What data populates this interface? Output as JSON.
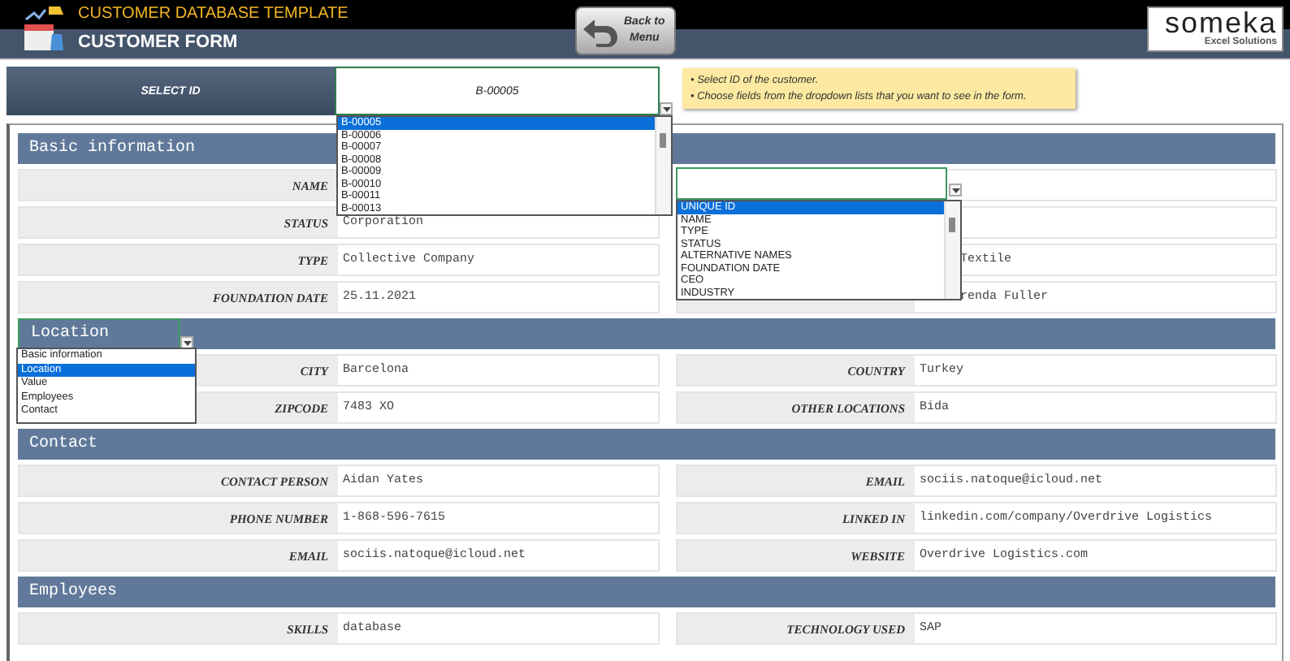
{
  "header": {
    "app_title": "CUSTOMER DATABASE TEMPLATE",
    "form_title": "CUSTOMER FORM",
    "back_button": [
      "Back to",
      "Menu"
    ],
    "logo": {
      "name": "someka",
      "tagline": "Excel Solutions"
    }
  },
  "select_id": {
    "label": "SELECT ID",
    "value": "B-00005",
    "options": [
      {
        "label": "B-00005",
        "selected": true
      },
      {
        "label": "B-00006",
        "selected": false
      },
      {
        "label": "B-00007",
        "selected": false
      },
      {
        "label": "B-00008",
        "selected": false
      },
      {
        "label": "B-00009",
        "selected": false
      },
      {
        "label": "B-00010",
        "selected": false
      },
      {
        "label": "B-00011",
        "selected": false
      },
      {
        "label": "B-00013",
        "selected": false
      }
    ]
  },
  "notes": [
    "• Select ID of the customer.",
    "• Choose fields from the dropdown lists that you want to see in the form."
  ],
  "field_picker": {
    "options": [
      {
        "label": "UNIQUE ID",
        "selected": true
      },
      {
        "label": "NAME",
        "selected": false
      },
      {
        "label": "TYPE",
        "selected": false
      },
      {
        "label": "STATUS",
        "selected": false
      },
      {
        "label": "ALTERNATIVE NAMES",
        "selected": false
      },
      {
        "label": "FOUNDATION DATE",
        "selected": false
      },
      {
        "label": "CEO",
        "selected": false
      },
      {
        "label": "INDUSTRY",
        "selected": false
      }
    ]
  },
  "sections": [
    {
      "kind": "header",
      "title": "Basic information",
      "left": [
        {
          "label": "NAME"
        },
        {
          "label": "STATUS",
          "value": "Corporation"
        },
        {
          "label": "TYPE",
          "value": "Collective Company"
        },
        {
          "label": "FOUNDATION DATE",
          "value": "25.11.2021"
        }
      ],
      "right": [
        {
          "value": "Textile"
        },
        {
          "value": "renda Fuller"
        }
      ]
    },
    {
      "kind": "dropdown",
      "title": "Location",
      "options": [
        {
          "label": "Basic information",
          "selected": false
        },
        {
          "label": "Location",
          "selected": true
        },
        {
          "label": "Value",
          "selected": false
        },
        {
          "label": "Employees",
          "selected": false
        },
        {
          "label": "Contact",
          "selected": false
        }
      ],
      "left": [
        {
          "label": "CITY",
          "value": "Barcelona"
        },
        {
          "label": "ZIPCODE",
          "value": "7483 XO"
        }
      ],
      "right": [
        {
          "label": "COUNTRY",
          "value": "Turkey"
        },
        {
          "label": "OTHER LOCATIONS",
          "value": "Bida"
        }
      ]
    },
    {
      "kind": "header",
      "title": "Contact",
      "left": [
        {
          "label": "CONTACT PERSON",
          "value": "Aidan Yates"
        },
        {
          "label": "PHONE NUMBER",
          "value": "1-868-596-7615"
        },
        {
          "label": "EMAIL",
          "value": "sociis.natoque@icloud.net"
        }
      ],
      "right": [
        {
          "label": "EMAIL",
          "value": "sociis.natoque@icloud.net"
        },
        {
          "label": "LINKED IN",
          "value": "linkedin.com/company/Overdrive Logistics"
        },
        {
          "label": "WEBSITE",
          "value": "Overdrive Logistics.com"
        }
      ]
    },
    {
      "kind": "header",
      "title": "Employees",
      "left": [
        {
          "label": "SKILLS",
          "value": "database"
        }
      ],
      "right": [
        {
          "label": "TECHNOLOGY USED",
          "value": "SAP"
        }
      ]
    }
  ]
}
